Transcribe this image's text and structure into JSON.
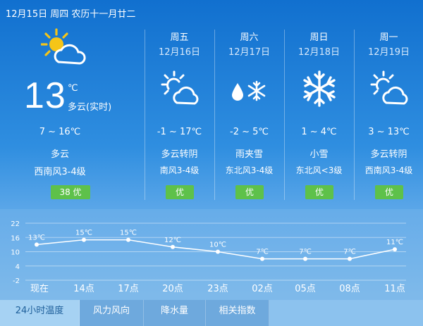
{
  "header": {
    "date_line": "12月15日 周四 农历十一月廿二"
  },
  "today": {
    "temp_now": "13",
    "temp_unit": "℃",
    "condition_now": "多云(实时)",
    "temp_range": "7 ~ 16℃",
    "condition": "多云",
    "wind": "西南风3-4级",
    "aqi": "38 优",
    "icon": "partly-cloudy-sun"
  },
  "forecast": [
    {
      "weekday": "周五",
      "date": "12月16日",
      "icon": "partly-cloudy-sun",
      "temp_range": "-1 ~ 17℃",
      "condition": "多云转阴",
      "wind": "南风3-4级",
      "aqi": "优"
    },
    {
      "weekday": "周六",
      "date": "12月17日",
      "icon": "sleet",
      "temp_range": "-2 ~ 5℃",
      "condition": "雨夹雪",
      "wind": "东北风3-4级",
      "aqi": "优"
    },
    {
      "weekday": "周日",
      "date": "12月18日",
      "icon": "snowflake",
      "temp_range": "1 ~ 4℃",
      "condition": "小雪",
      "wind": "东北风<3级",
      "aqi": "优"
    },
    {
      "weekday": "周一",
      "date": "12月19日",
      "icon": "partly-cloudy-sun",
      "temp_range": "3 ~ 13℃",
      "condition": "多云转阴",
      "wind": "西南风3-4级",
      "aqi": "优"
    }
  ],
  "chart_data": {
    "type": "line",
    "categories": [
      "现在",
      "14点",
      "17点",
      "20点",
      "23点",
      "02点",
      "05点",
      "08点",
      "11点"
    ],
    "values": [
      13,
      15,
      15,
      12,
      10,
      7,
      7,
      7,
      11
    ],
    "value_labels": [
      "13℃",
      "15℃",
      "15℃",
      "12℃",
      "10℃",
      "7℃",
      "7℃",
      "7℃",
      "11℃"
    ],
    "yticks": [
      "22",
      "16",
      "10",
      "4",
      "-2"
    ],
    "ylim": [
      -2,
      22
    ],
    "grid": true,
    "line_color": "#ffffff"
  },
  "tabs": [
    {
      "label": "24小时温度",
      "active": true
    },
    {
      "label": "风力风向",
      "active": false
    },
    {
      "label": "降水量",
      "active": false
    },
    {
      "label": "相关指数",
      "active": false
    }
  ],
  "colors": {
    "aqi_good": "#5ec14a",
    "sun": "#f5c518"
  }
}
